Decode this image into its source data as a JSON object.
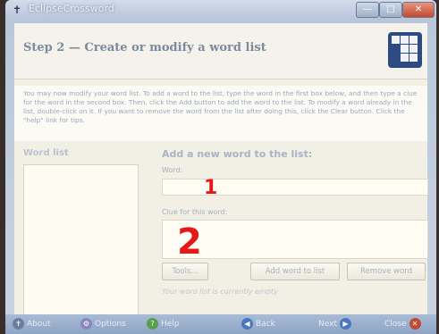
{
  "window": {
    "title": "EclipseCrossword",
    "min_glyph": "—",
    "max_glyph": "□",
    "close_glyph": "✕"
  },
  "header": {
    "step_title": "Step 2 — Create or modify a word list"
  },
  "instructions": "You may now modify your word list. To add a word to the list, type the word in the first box below, and then type a clue for the word in the second box. Then, click the Add button to add the word to the list. To modify a word already in the list, double-click on it. If you want to remove the word from the list after doing this, click the Clear button. Click the \"help\" link for tips.",
  "word_list": {
    "label": "Word list"
  },
  "add_panel": {
    "heading": "Add a new word to the list:",
    "word_label": "Word:",
    "word_value": "",
    "clue_label": "Clue for this word:",
    "clue_value": "",
    "tools_label": "Tools...",
    "add_label": "Add word to list",
    "remove_label": "Remove word",
    "status": "Your word list is currently empty"
  },
  "annotations": {
    "one": "1",
    "two": "2"
  },
  "bottom_bar": {
    "about_label": "About",
    "options_label": "Options",
    "help_label": "Help",
    "back_label": "Back",
    "next_label": "Next",
    "close_label": "Close"
  },
  "colors": {
    "accent": "#2e4a82",
    "annotation": "#e21a1a",
    "close": "#c24a30"
  }
}
